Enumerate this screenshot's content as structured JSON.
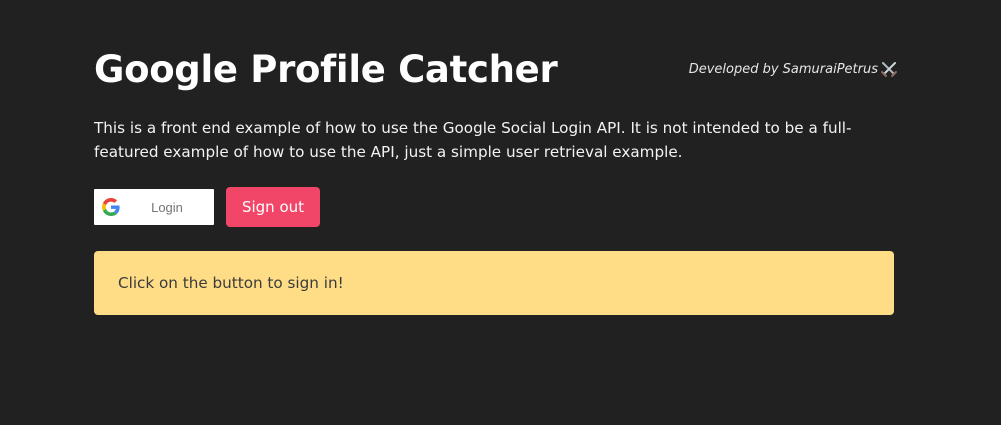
{
  "header": {
    "title": "Google Profile Catcher",
    "developer_credit": "Developed by SamuraiPetrus",
    "developer_icon": "crossed-swords-icon"
  },
  "description": "This is a front end example of how to use the Google Social Login API. It is not intended to be a full-featured example of how to use the API, just a simple user retrieval example.",
  "buttons": {
    "google_login_label": "Login",
    "google_icon": "google-g-icon",
    "signout_label": "Sign out"
  },
  "notice": {
    "message": "Click on the button to sign in!"
  },
  "colors": {
    "background": "#212121",
    "signout_button": "#f14668",
    "notice_background": "#ffdd87",
    "title_text": "#ffffff"
  }
}
